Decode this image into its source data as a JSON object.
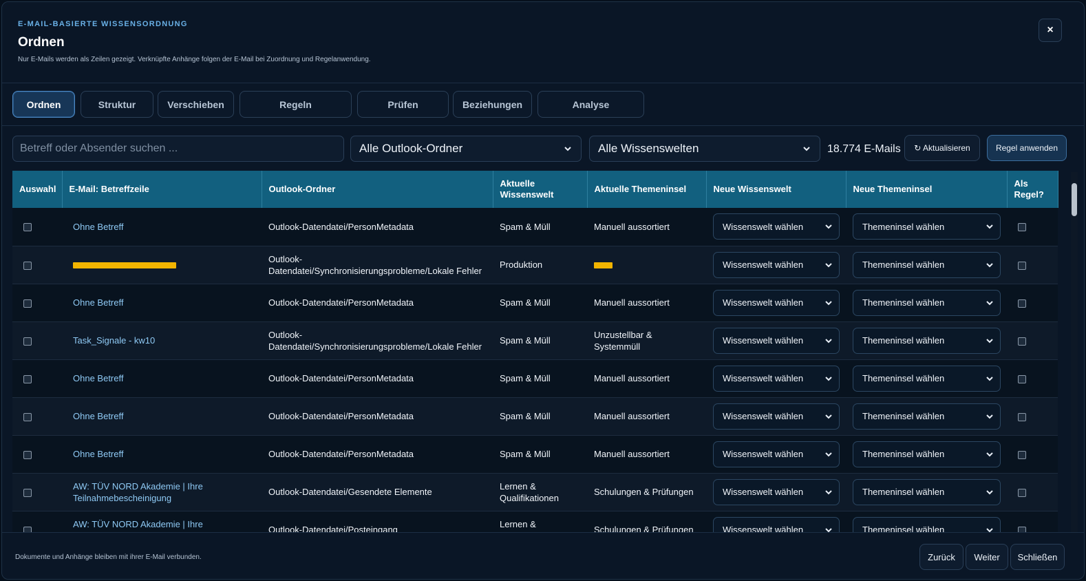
{
  "header": {
    "eyebrow": "E-MAIL-BASIERTE WISSENSORDNUNG",
    "title": "Ordnen",
    "subtitle": "Nur E-Mails werden als Zeilen gezeigt. Verknüpfte Anhänge folgen der E-Mail bei Zuordnung und Regelanwendung.",
    "close_label": "×"
  },
  "tabs": [
    {
      "label": "Ordnen",
      "active": true
    },
    {
      "label": "Struktur"
    },
    {
      "label": "Verschieben"
    },
    {
      "label": "Regeln"
    },
    {
      "label": "Prüfen"
    },
    {
      "label": "Beziehungen"
    },
    {
      "label": "Analyse"
    }
  ],
  "toolbar": {
    "search_placeholder": "Betreff oder Absender suchen ...",
    "folder_filter": "Alle Outlook-Ordner",
    "world_filter": "Alle Wissenswelten",
    "count": "18.774 E-Mails",
    "refresh_label": "↻ Aktualisieren",
    "apply_rule_label": "Regel anwenden"
  },
  "table": {
    "columns": [
      "Auswahl",
      "E-Mail: Betreffzeile",
      "Outlook-Ordner",
      "Aktuelle Wissenswelt",
      "Aktuelle Themeninsel",
      "Neue Wissenswelt",
      "Neue Themeninsel",
      "Als Regel?"
    ],
    "select_world_placeholder": "Wissenswelt wählen",
    "select_island_placeholder": "Themeninsel wählen",
    "rows": [
      {
        "subject": "Ohne Betreff",
        "folder": "Outlook-Datendatei/PersonMetadata",
        "world": "Spam & Müll",
        "island": "Manuell aussortiert"
      },
      {
        "subject": "",
        "subject_redacted": true,
        "folder": "Outlook-Datendatei/Synchronisierungsprobleme/Lokale Fehler",
        "world": "Produktion",
        "island": "",
        "island_redacted": true
      },
      {
        "subject": "Ohne Betreff",
        "folder": "Outlook-Datendatei/PersonMetadata",
        "world": "Spam & Müll",
        "island": "Manuell aussortiert"
      },
      {
        "subject": "Task_Signale - kw10",
        "folder": "Outlook-Datendatei/Synchronisierungsprobleme/Lokale Fehler",
        "world": "Spam & Müll",
        "island": "Unzustellbar & Systemmüll"
      },
      {
        "subject": "Ohne Betreff",
        "folder": "Outlook-Datendatei/PersonMetadata",
        "world": "Spam & Müll",
        "island": "Manuell aussortiert"
      },
      {
        "subject": "Ohne Betreff",
        "folder": "Outlook-Datendatei/PersonMetadata",
        "world": "Spam & Müll",
        "island": "Manuell aussortiert"
      },
      {
        "subject": "Ohne Betreff",
        "folder": "Outlook-Datendatei/PersonMetadata",
        "world": "Spam & Müll",
        "island": "Manuell aussortiert"
      },
      {
        "subject": "AW: TÜV NORD Akademie | Ihre Teilnahmebescheinigung",
        "folder": "Outlook-Datendatei/Gesendete Elemente",
        "world": "Lernen & Qualifikationen",
        "island": "Schulungen & Prüfungen"
      },
      {
        "subject": "AW: TÜV NORD Akademie | Ihre Teilnahmebescheinigung",
        "folder": "Outlook-Datendatei/Posteingang",
        "world": "Lernen & Qualifikationen",
        "island": "Schulungen & Prüfungen"
      }
    ]
  },
  "footer": {
    "note": "Dokumente und Anhänge bleiben mit ihrer E-Mail verbunden.",
    "back_label": "Zurück",
    "next_label": "Weiter",
    "close_label": "Schließen"
  },
  "colors": {
    "background": "#0a1626",
    "header_row": "#12607f",
    "accent_link": "#8fcaf5",
    "redaction": "#f2b400"
  }
}
